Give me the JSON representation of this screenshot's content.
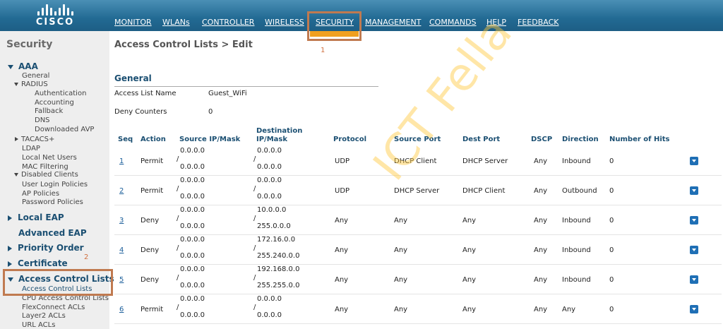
{
  "brand": {
    "logo_text": "CISCO"
  },
  "nav": {
    "items": [
      "MONITOR",
      "WLANs",
      "CONTROLLER",
      "WIRELESS",
      "SECURITY",
      "MANAGEMENT",
      "COMMANDS",
      "HELP",
      "FEEDBACK"
    ],
    "active": "SECURITY"
  },
  "annotations": {
    "one": "1",
    "two": "2"
  },
  "sidebar": {
    "title": "Security",
    "aaa": "AAA",
    "general": "General",
    "radius": "RADIUS",
    "authentication": "Authentication",
    "accounting": "Accounting",
    "fallback": "Fallback",
    "dns": "DNS",
    "downloaded_avp": "Downloaded AVP",
    "tacacs": "TACACS+",
    "ldap": "LDAP",
    "local_net_users": "Local Net Users",
    "mac_filtering": "MAC Filtering",
    "disabled_clients": "Disabled Clients",
    "user_login_policies": "User Login Policies",
    "ap_policies": "AP Policies",
    "password_policies": "Password Policies",
    "local_eap": "Local EAP",
    "advanced_eap": "Advanced EAP",
    "priority_order": "Priority Order",
    "certificate": "Certificate",
    "access_control_lists": "Access Control Lists",
    "acl_sub": "Access Control Lists",
    "cpu_acl": "CPU Access Control Lists",
    "flexconnect_acls": "FlexConnect ACLs",
    "layer2_acls": "Layer2 ACLs",
    "url_acls": "URL ACLs"
  },
  "main": {
    "page_title": "Access Control Lists > Edit",
    "section_title": "General",
    "acl_name_label": "Access List Name",
    "acl_name_value": "Guest_WiFi",
    "deny_counters_label": "Deny Counters",
    "deny_counters_value": "0"
  },
  "table": {
    "headers": {
      "seq": "Seq",
      "action": "Action",
      "source": "Source IP/Mask",
      "dest_top": "Destination",
      "dest_bottom": "IP/Mask",
      "protocol": "Protocol",
      "source_port": "Source Port",
      "dest_port": "Dest Port",
      "dscp": "DSCP",
      "direction": "Direction",
      "hits": "Number of Hits"
    },
    "rows": [
      {
        "seq": "1",
        "action": "Permit",
        "src_ip": "0.0.0.0",
        "src_mask": "0.0.0.0",
        "dst_ip": "0.0.0.0",
        "dst_mask": "0.0.0.0",
        "protocol": "UDP",
        "source_port": "DHCP Client",
        "dest_port": "DHCP Server",
        "dscp": "Any",
        "direction": "Inbound",
        "hits": "0"
      },
      {
        "seq": "2",
        "action": "Permit",
        "src_ip": "0.0.0.0",
        "src_mask": "0.0.0.0",
        "dst_ip": "0.0.0.0",
        "dst_mask": "0.0.0.0",
        "protocol": "UDP",
        "source_port": "DHCP Server",
        "dest_port": "DHCP Client",
        "dscp": "Any",
        "direction": "Outbound",
        "hits": "0"
      },
      {
        "seq": "3",
        "action": "Deny",
        "src_ip": "0.0.0.0",
        "src_mask": "0.0.0.0",
        "dst_ip": "10.0.0.0",
        "dst_mask": "255.0.0.0",
        "protocol": "Any",
        "source_port": "Any",
        "dest_port": "Any",
        "dscp": "Any",
        "direction": "Inbound",
        "hits": "0"
      },
      {
        "seq": "4",
        "action": "Deny",
        "src_ip": "0.0.0.0",
        "src_mask": "0.0.0.0",
        "dst_ip": "172.16.0.0",
        "dst_mask": "255.240.0.0",
        "protocol": "Any",
        "source_port": "Any",
        "dest_port": "Any",
        "dscp": "Any",
        "direction": "Inbound",
        "hits": "0"
      },
      {
        "seq": "5",
        "action": "Deny",
        "src_ip": "0.0.0.0",
        "src_mask": "0.0.0.0",
        "dst_ip": "192.168.0.0",
        "dst_mask": "255.255.0.0",
        "protocol": "Any",
        "source_port": "Any",
        "dest_port": "Any",
        "dscp": "Any",
        "direction": "Inbound",
        "hits": "0"
      },
      {
        "seq": "6",
        "action": "Permit",
        "src_ip": "0.0.0.0",
        "src_mask": "0.0.0.0",
        "dst_ip": "0.0.0.0",
        "dst_mask": "0.0.0.0",
        "protocol": "Any",
        "source_port": "Any",
        "dest_port": "Any",
        "dscp": "Any",
        "direction": "Any",
        "hits": "0"
      }
    ],
    "slash": "/"
  },
  "watermark": "ICT Fella",
  "colors": {
    "nav_bg": "#226a93",
    "active_tab": "#f0a020",
    "annotation_box": "#c07a50",
    "heading": "#1b4f72"
  }
}
